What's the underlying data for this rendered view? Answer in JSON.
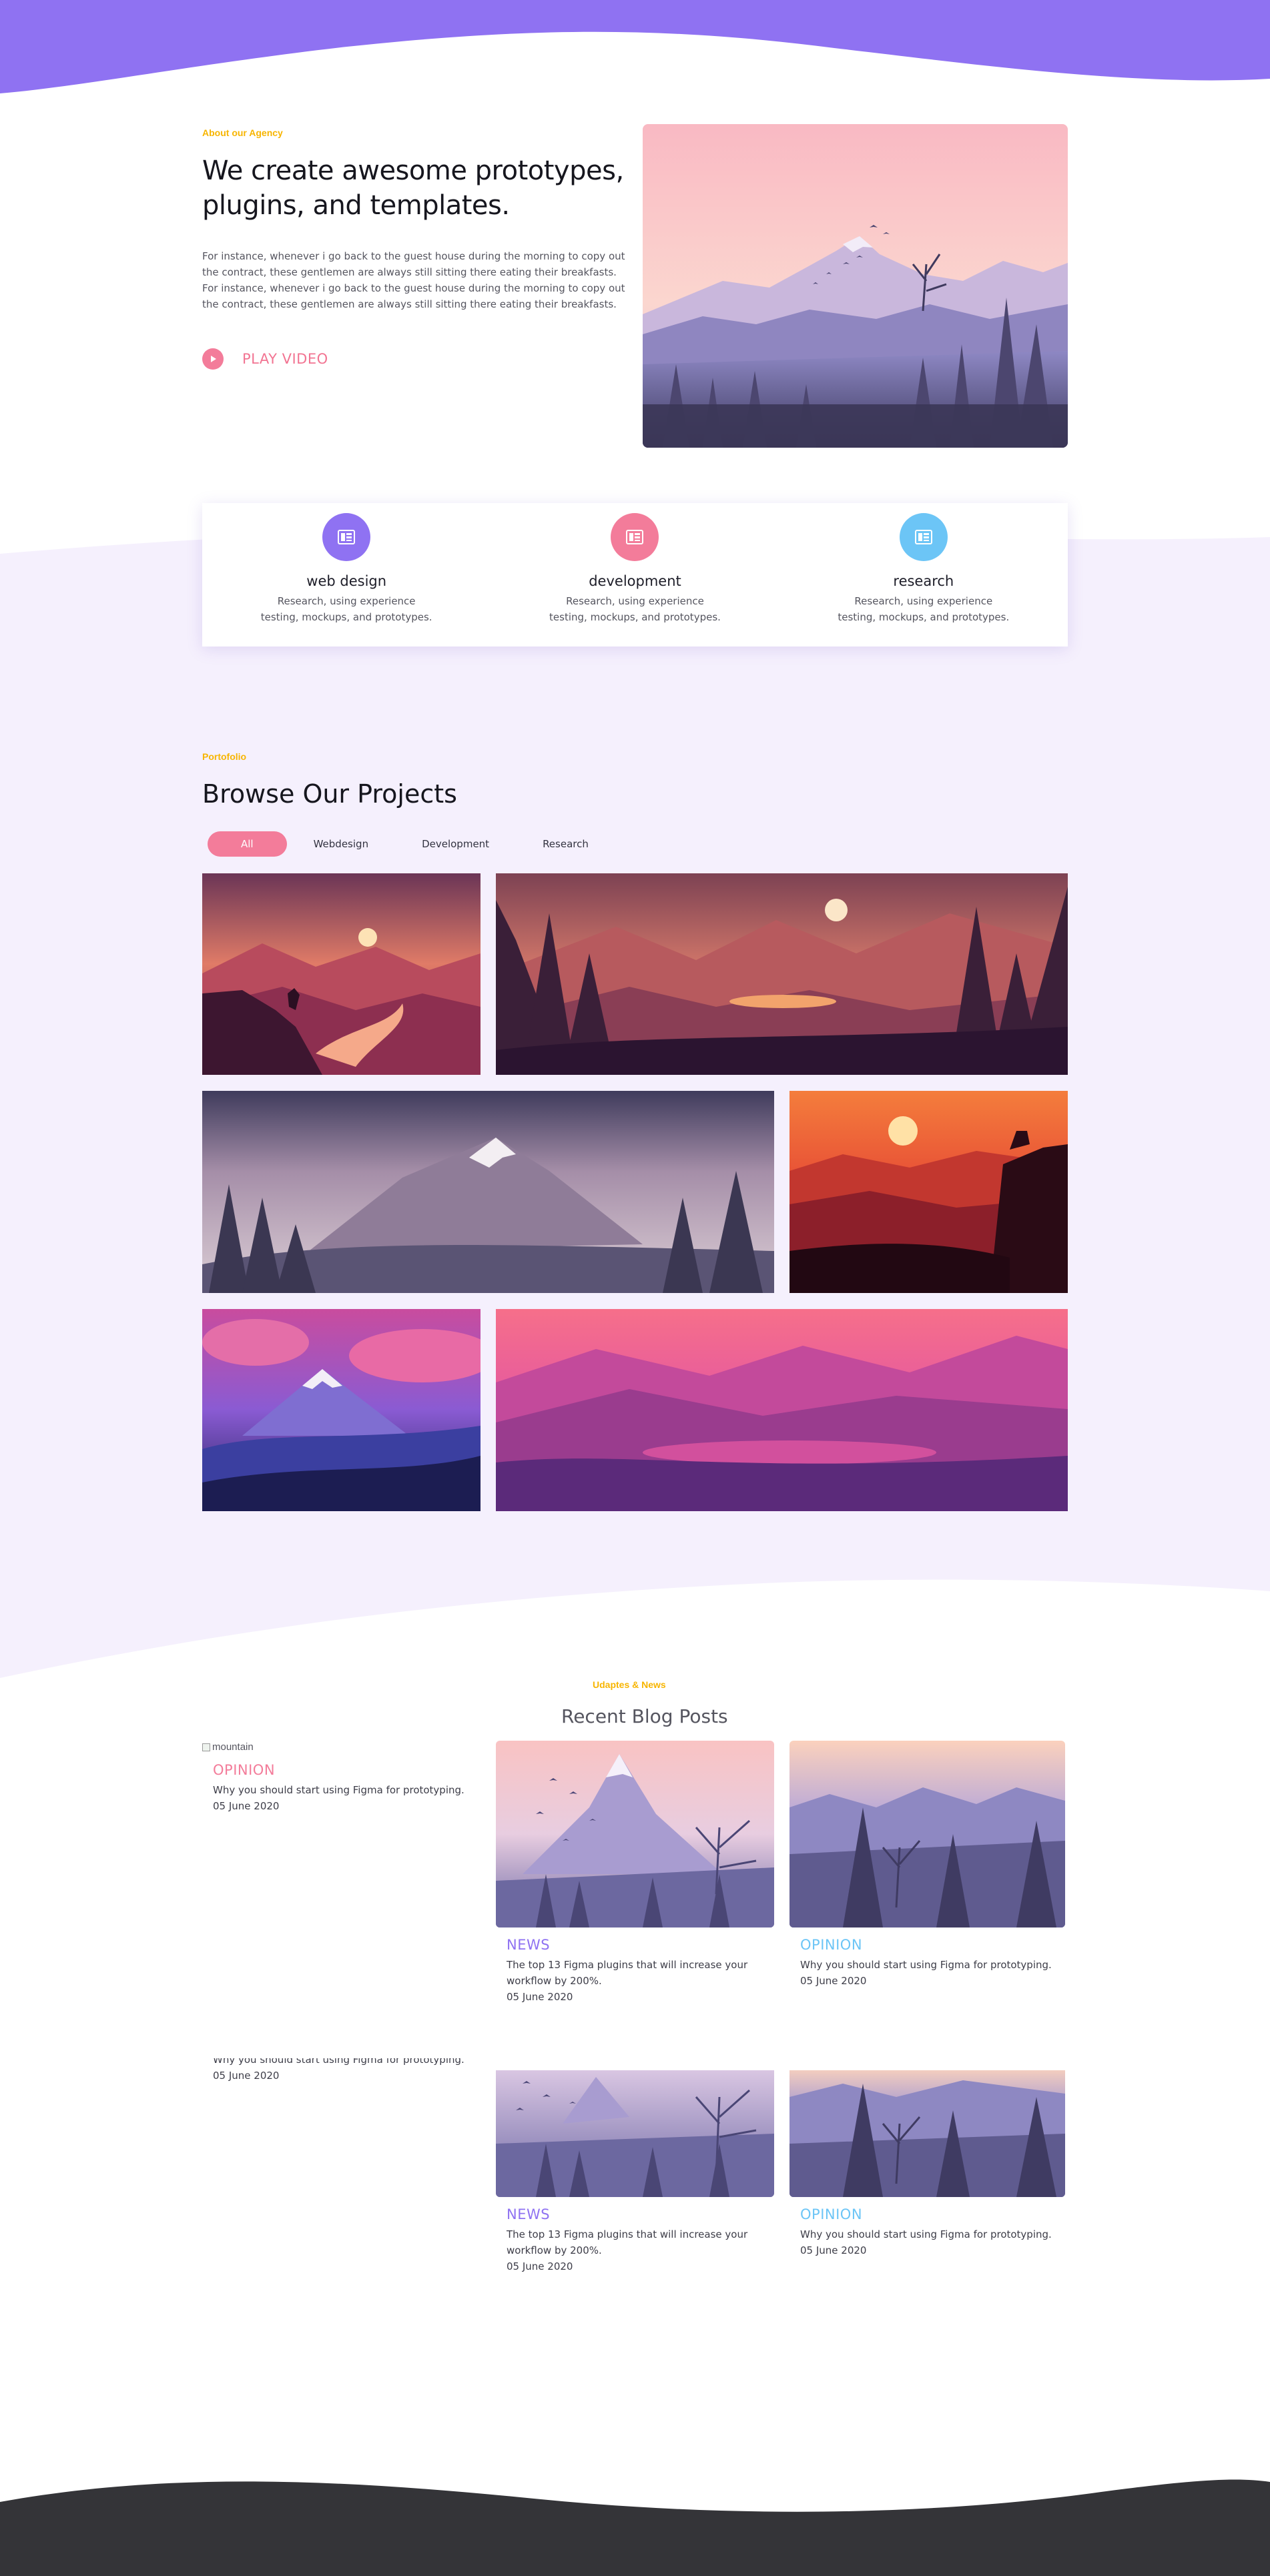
{
  "colors": {
    "purple": "#8f72f2",
    "lavender_bg": "#f5f0fd",
    "yellow": "#f7b500",
    "pink": "#f37c9a",
    "blue": "#6cc5f6",
    "dark_footer": "#343438"
  },
  "about": {
    "eyebrow": "About our Agency",
    "title": "We create awesome prototypes, plugins, and templates.",
    "text": "For instance, whenever i go back to the guest house during the morning to copy out the contract, these gentlemen are always still sitting there eating their breakfasts. For instance, whenever i go back to the guest house during the morning to copy out the contract, these gentlemen are always still sitting there eating their breakfasts.",
    "play_label": "PLAY VIDEO",
    "play_icon": "play-icon"
  },
  "services": [
    {
      "title": "web design",
      "desc": "Research, using experience testing, mockups, and prototypes.",
      "icon": "layout-icon",
      "color": "#8f72f2"
    },
    {
      "title": "development",
      "desc": "Research, using experience testing, mockups, and prototypes.",
      "icon": "layout-icon",
      "color": "#f37c9a"
    },
    {
      "title": "research",
      "desc": "Research, using experience testing, mockups, and prototypes.",
      "icon": "layout-icon",
      "color": "#6cc5f6"
    }
  ],
  "portfolio": {
    "eyebrow": "Portofolio",
    "title": "Browse Our Projects",
    "filters": [
      "All",
      "Webdesign",
      "Development",
      "Research"
    ],
    "active_filter": "All"
  },
  "blog": {
    "eyebrow": "Udaptes & News",
    "title": "Recent Blog Posts",
    "broken_image_alt": "mountain",
    "posts": [
      {
        "category": "OPINION",
        "desc": "Why you should start using Figma for prototyping.",
        "date": "05 June 2020",
        "color": "#f37c9a"
      },
      {
        "category": "NEWS",
        "desc": "The top 13 Figma plugins that will increase your workflow by 200%.",
        "date": "05 June 2020",
        "color": "#8f72f2"
      },
      {
        "category": "OPINION",
        "desc": "Why you should start using Figma for prototyping.",
        "date": "05 June 2020",
        "color": "#6cc5f6"
      },
      {
        "category": "",
        "desc": "Why you should start using Figma for prototyping.",
        "date": "05 June 2020",
        "color": "#f37c9a"
      },
      {
        "category": "NEWS",
        "desc": "The top 13 Figma plugins that will increase your workflow by 200%.",
        "date": "05 June 2020",
        "color": "#8f72f2"
      },
      {
        "category": "OPINION",
        "desc": "Why you should start using Figma for prototyping.",
        "date": "05 June 2020",
        "color": "#6cc5f6"
      }
    ]
  }
}
